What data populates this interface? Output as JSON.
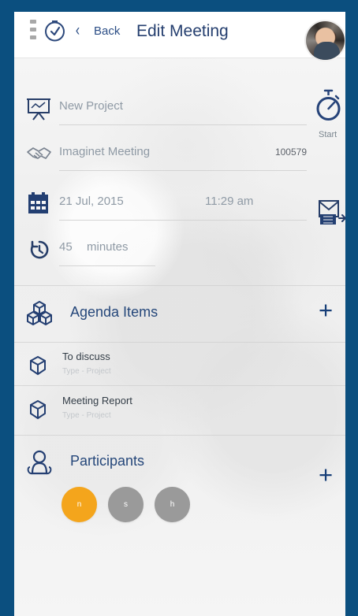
{
  "header": {
    "back_label": "Back",
    "title": "Edit Meeting",
    "back_glyph": "‹"
  },
  "meeting": {
    "project": "New Project",
    "name": "Imaginet Meeting",
    "meeting_id": "100579",
    "date": "21 Jul, 2015",
    "time": "11:29 am",
    "duration_value": "45",
    "duration_unit": "minutes"
  },
  "actions": {
    "start_label": "Start"
  },
  "agenda": {
    "title": "Agenda Items",
    "add_glyph": "+",
    "items": [
      {
        "title": "To discuss",
        "subtitle": "Type - Project"
      },
      {
        "title": "Meeting Report",
        "subtitle": "Type - Project"
      }
    ]
  },
  "participants": {
    "title": "Participants",
    "add_glyph": "+",
    "items": [
      {
        "initial": "n",
        "color": "#f4a51c"
      },
      {
        "initial": "s",
        "color": "#9a9a9a"
      },
      {
        "initial": "h",
        "color": "#9a9a9a"
      }
    ]
  },
  "icons": [
    "menu-icon",
    "timer-icon",
    "presentation-icon",
    "handshake-icon",
    "calendar-icon",
    "clock-icon",
    "stopwatch-icon",
    "email-forward-icon",
    "agenda-cubes-icon",
    "cube-icon",
    "participants-icon",
    "plus-icon"
  ],
  "colors": {
    "frame": "#0b4f7f",
    "primary_text": "#25477a",
    "participant_active": "#f4a51c",
    "participant_inactive": "#9a9a9a"
  }
}
